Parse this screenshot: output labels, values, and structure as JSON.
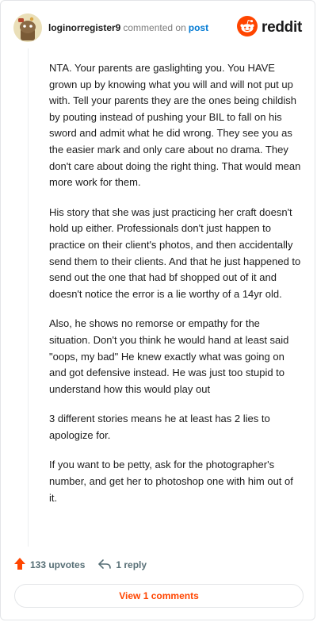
{
  "header": {
    "username": "loginorregister9",
    "commented_text": "commented on",
    "post_link": "post",
    "brand": "reddit",
    "brand_color": "#ff4500",
    "avatar_icon": "snoo-avatar-icon"
  },
  "comment": {
    "paragraphs": [
      "NTA. Your parents are gaslighting you. You HAVE grown up by knowing what you will and will not put up with. Tell your parents they are the ones being childish by pouting instead of pushing your BIL to fall on his sword and admit what he did wrong. They see you as the easier mark and only care about no drama. They don't care about doing the right thing. That would mean more work for them.",
      "His story that she was just practicing her craft doesn't hold up either. Professionals don't just happen to practice on their client's photos, and then accidentally send them to their clients. And that he just happened to send out the one that had bf shopped out of it and doesn't notice the error is a lie worthy of a 14yr old.",
      "Also, he shows no remorse or empathy for the situation. Don't you think he would hand at least said \"oops, my bad\" He knew exactly what was going on and got defensive instead. He was just too stupid to understand how this would play out",
      "3 different stories means he at least has 2 lies to apologize for.",
      "If you want to be petty, ask for the photographer's number, and get her to photoshop one with him out of it."
    ]
  },
  "actions": {
    "upvotes_label": "133 upvotes",
    "reply_label": "1 reply",
    "upvote_icon": "upvote-arrow-icon",
    "reply_icon": "reply-arrow-icon",
    "upvote_color": "#ff4500"
  },
  "footer": {
    "view_comments_label": "View 1 comments"
  }
}
